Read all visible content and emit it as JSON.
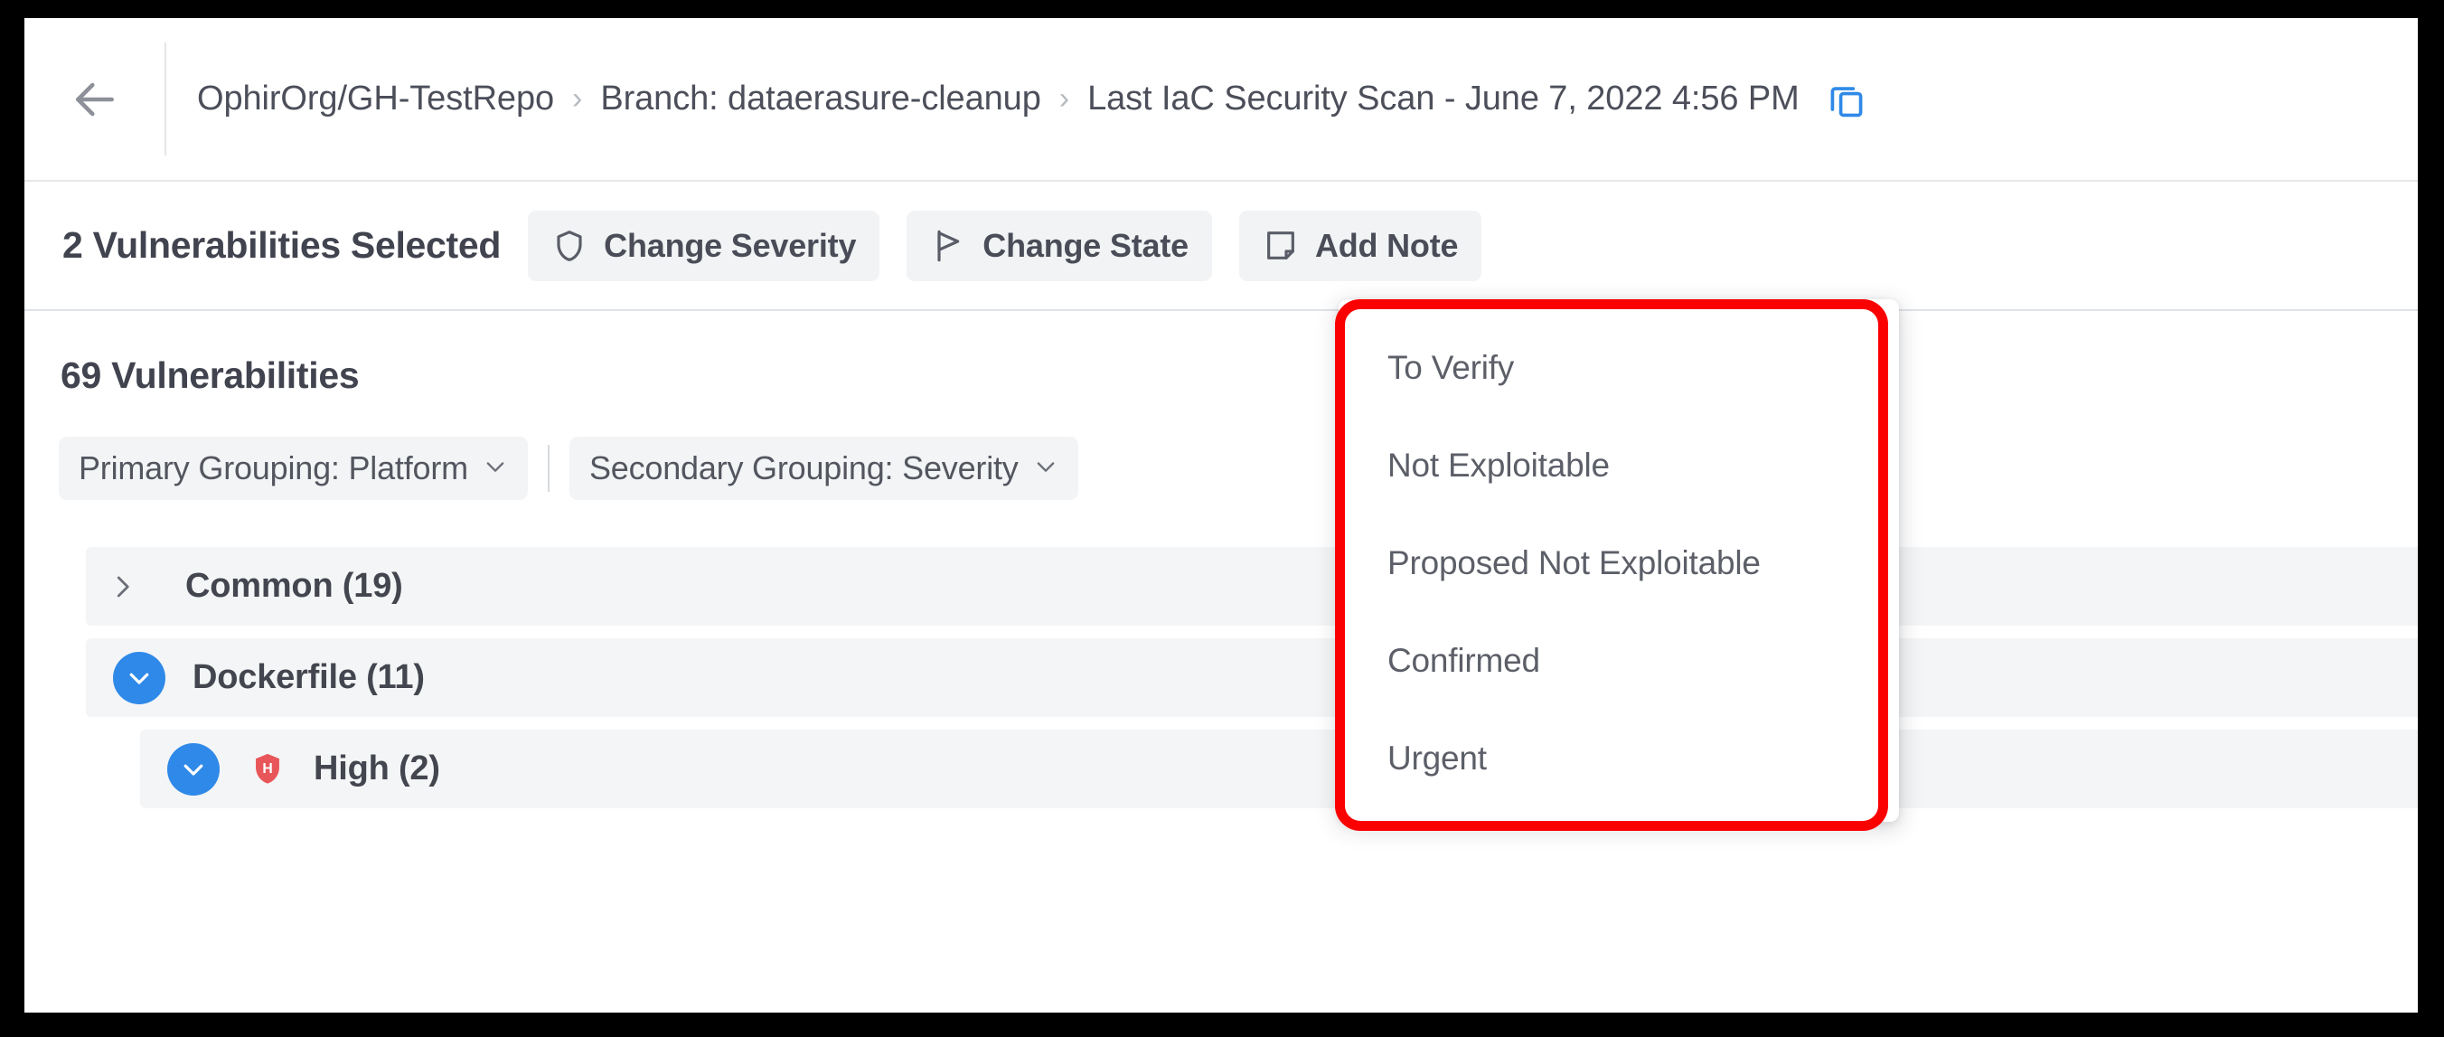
{
  "breadcrumb": {
    "back_label": "Back",
    "separator": "›",
    "items": [
      {
        "label": "OphirOrg/GH-TestRepo"
      },
      {
        "label": "Branch: dataerasure-cleanup"
      },
      {
        "label": "Last IaC Security Scan - June 7, 2022 4:56 PM"
      }
    ],
    "copy_icon": "copy-icon",
    "copy_icon_color": "#2f89e8"
  },
  "action_bar": {
    "selection_title": "2 Vulnerabilities Selected",
    "buttons": [
      {
        "label": "Change Severity",
        "icon": "shield-icon"
      },
      {
        "label": "Change State",
        "icon": "flag-icon"
      },
      {
        "label": "Add Note",
        "icon": "note-icon"
      }
    ]
  },
  "content": {
    "vuln_count_title": "69 Vulnerabilities",
    "grouping": [
      {
        "label": "Primary Grouping: Platform",
        "icon": "chevron-down-icon"
      },
      {
        "label": "Secondary Grouping: Severity",
        "icon": "chevron-down-icon"
      }
    ],
    "groups": [
      {
        "name": "Common (19)",
        "level": 1,
        "expanded": false,
        "toggle_icon": "chevron-right-icon",
        "severity": null
      },
      {
        "name": "Dockerfile (11)",
        "level": 1,
        "expanded": true,
        "toggle_icon": "chevron-down-icon",
        "severity": null
      },
      {
        "name": "High (2)",
        "level": 2,
        "expanded": true,
        "toggle_icon": "chevron-down-icon",
        "severity": {
          "letter": "H",
          "label": "High",
          "color": "#e8565a"
        }
      }
    ]
  },
  "state_menu": {
    "items": [
      {
        "label": "To Verify"
      },
      {
        "label": "Not Exploitable"
      },
      {
        "label": "Proposed Not Exploitable"
      },
      {
        "label": "Confirmed"
      },
      {
        "label": "Urgent"
      }
    ],
    "highlight_color": "#fb0000"
  },
  "theme": {
    "accent_blue": "#2f89e8",
    "text_dark": "#41444f",
    "text_muted": "#5c5f68",
    "chip_bg": "#f2f3f5",
    "row_bg": "#f4f5f6"
  }
}
